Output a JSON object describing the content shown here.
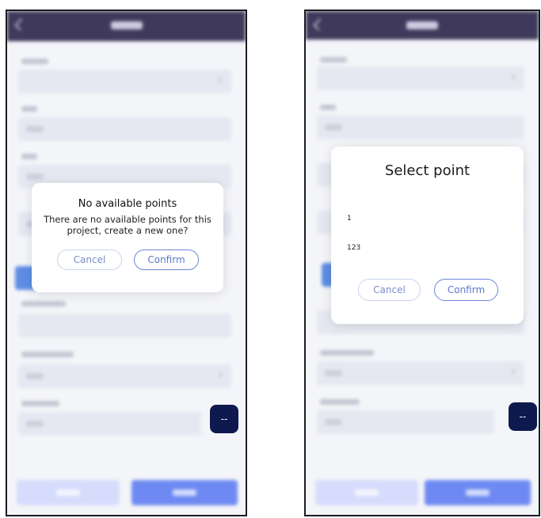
{
  "left_screen": {
    "fab_label": "--",
    "dialog": {
      "title": "No available points",
      "message": "There are no available points for this project, create a new one?",
      "cancel_label": "Cancel",
      "confirm_label": "Confirm"
    }
  },
  "right_screen": {
    "fab_label": "--",
    "dialog": {
      "title": "Select point",
      "options": [
        "1",
        "123"
      ],
      "cancel_label": "Cancel",
      "confirm_label": "Confirm"
    }
  },
  "icons": {
    "back": "chevron-left-icon",
    "dropdown": "chevron-down-icon"
  },
  "colors": {
    "header": "#3f3a5b",
    "fab": "#0e1a4e",
    "primary_button": "#6e8af2",
    "secondary_button": "#d6dcfb",
    "confirm_border": "#6a86d8",
    "cancel_border": "#c9d4ee"
  }
}
